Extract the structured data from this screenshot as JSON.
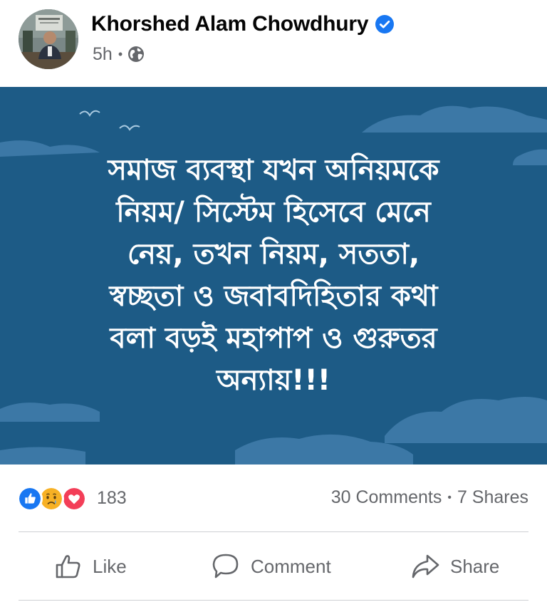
{
  "post": {
    "author": "Khorshed Alam Chowdhury",
    "timestamp": "5h",
    "meta_separator": "•",
    "privacy_icon": "globe-icon",
    "verified_icon": "verified-badge-icon",
    "image_text_lines": [
      "সমাজ ব্যবস্থা যখন অনিয়মকে",
      "নিয়ম/ সিস্টেম হিসেবে মেনে",
      "নেয়, তখন নিয়ম, সততা,",
      "স্বচ্ছতা ও জবাবদিহিতার কথা",
      "বলা বড়ই মহাপাপ ও গুরুতর",
      "অন্যায়!!!"
    ]
  },
  "reactions": {
    "icons": [
      "like-reaction-icon",
      "sad-reaction-icon",
      "love-reaction-icon"
    ],
    "count": "183"
  },
  "stats": {
    "comments": "30 Comments",
    "separator": "•",
    "shares": "7 Shares"
  },
  "actions": {
    "like": "Like",
    "comment": "Comment",
    "share": "Share"
  },
  "colors": {
    "background": "#1d5b86",
    "cloud": "#3c78a6",
    "verified": "#1877f2",
    "like": "#1877f2",
    "love": "#f33e58",
    "sad": "#f7b125",
    "muted_text": "#65676b"
  }
}
